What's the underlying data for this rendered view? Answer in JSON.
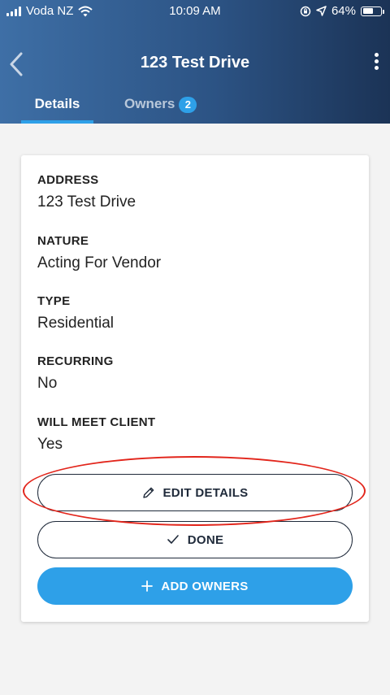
{
  "status_bar": {
    "carrier": "Voda NZ",
    "time": "10:09 AM",
    "battery": "64%",
    "battery_level": 0.64
  },
  "nav": {
    "title": "123 Test Drive",
    "back_icon": "chevron-left-icon",
    "more_icon": "more-vertical-icon"
  },
  "tabs": [
    {
      "label": "Details",
      "active": true
    },
    {
      "label": "Owners",
      "badge": "2",
      "active": false
    }
  ],
  "details": [
    {
      "label": "ADDRESS",
      "value": "123 Test Drive"
    },
    {
      "label": "NATURE",
      "value": "Acting For Vendor"
    },
    {
      "label": "TYPE",
      "value": "Residential"
    },
    {
      "label": "RECURRING",
      "value": "No"
    },
    {
      "label": "WILL MEET CLIENT",
      "value": "Yes"
    }
  ],
  "actions": {
    "edit_label": "EDIT DETAILS",
    "done_label": "DONE",
    "add_owners_label": "ADD OWNERS"
  },
  "colors": {
    "accent": "#2ea0e8",
    "header_start": "#3e6fa6",
    "header_end": "#1b3356",
    "annotation": "#e2251b"
  }
}
